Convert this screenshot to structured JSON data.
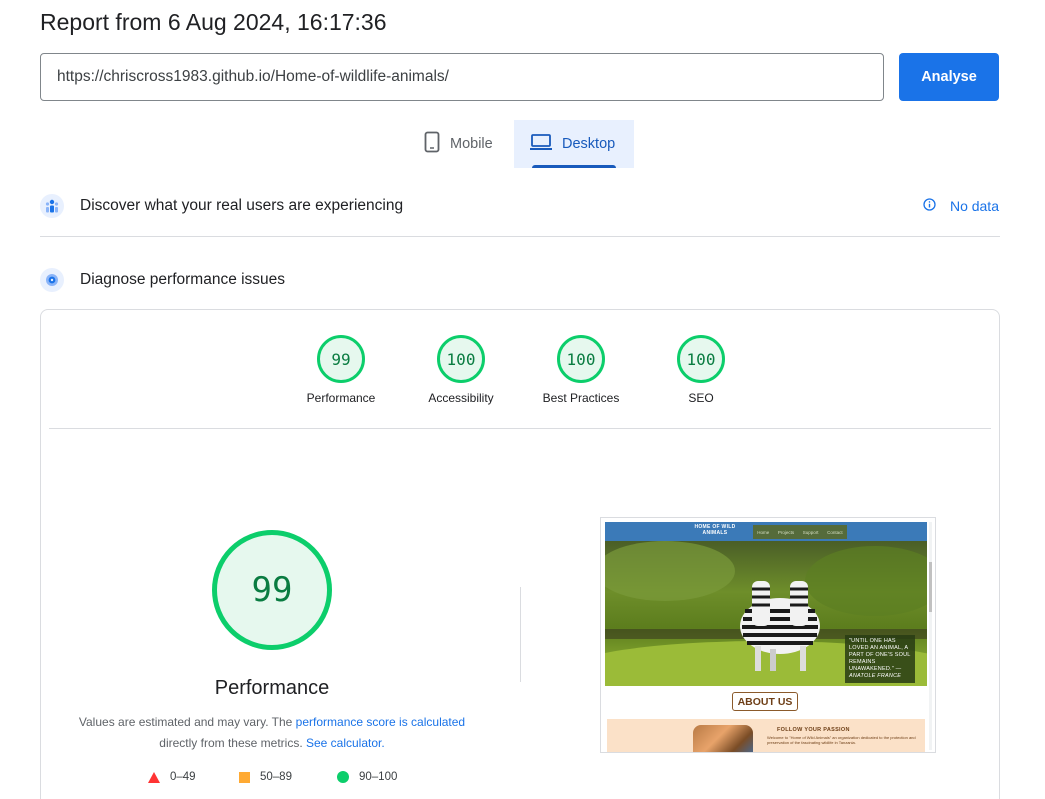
{
  "header": {
    "title": "Report from 6 Aug 2024, 16:17:36"
  },
  "search": {
    "url": "https://chriscross1983.github.io/Home-of-wildlife-animals/",
    "analyse_label": "Analyse"
  },
  "tabs": [
    {
      "label": "Mobile",
      "icon": "smartphone-icon",
      "selected": false
    },
    {
      "label": "Desktop",
      "icon": "laptop-icon",
      "selected": true
    }
  ],
  "crux": {
    "label": "Discover what your real users are experiencing",
    "status": "No data",
    "icon": "users-icon"
  },
  "diagnose": {
    "label": "Diagnose performance issues",
    "icon": "lighthouse-icon"
  },
  "scores": [
    {
      "value": "99",
      "label": "Performance"
    },
    {
      "value": "100",
      "label": "Accessibility"
    },
    {
      "value": "100",
      "label": "Best Practices"
    },
    {
      "value": "100",
      "label": "SEO"
    }
  ],
  "performance": {
    "score": "99",
    "title": "Performance",
    "desc_before": "Values are estimated and may vary. The ",
    "desc_link1": "performance score is calculated",
    "desc_middle": " directly from these metrics. ",
    "desc_link2": "See calculator."
  },
  "legend": [
    {
      "range": "0–49",
      "shape": "triangle",
      "color": "#ff3333"
    },
    {
      "range": "50–89",
      "shape": "square",
      "color": "#ffaa33"
    },
    {
      "range": "90–100",
      "shape": "circle",
      "color": "#0cce6b"
    }
  ],
  "screenshot": {
    "brand": "HOME OF WILD ANIMALS",
    "menu": [
      "Home",
      "Projects",
      "Support",
      "Contact"
    ],
    "quote": "\"UNTIL ONE HAS LOVED AN ANIMAL, A PART OF ONE'S SOUL REMAINS UNAWAKENED.\" —",
    "quote_author": "ANATOLE FRANCE",
    "about": "ABOUT US",
    "passion_title": "FOLLOW YOUR PASSION",
    "passion_text": "Welcome to \"Home of Wild Animals\" an organization dedicated to the protection and preservation of the fascinating wildlife in Tanzania."
  },
  "colors": {
    "accent": "#1a73e8",
    "good": "#0cce6b",
    "average": "#ffaa33",
    "poor": "#ff3333"
  }
}
